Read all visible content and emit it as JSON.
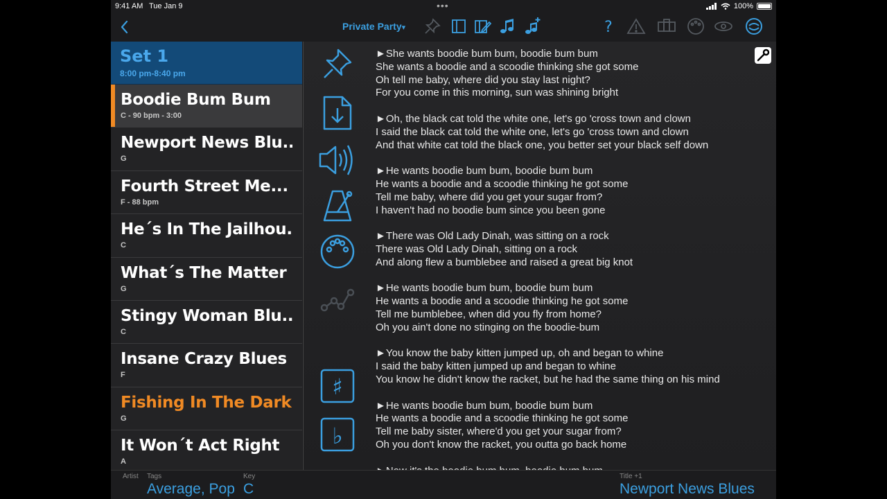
{
  "status_bar": {
    "time": "9:41 AM",
    "date": "Tue Jan 9",
    "battery": "100%"
  },
  "nav": {
    "set_name": "Private Party",
    "set_dropdown_glyph": "▾"
  },
  "set": {
    "name": "Set 1",
    "time": "8:00 pm-8:40 pm"
  },
  "songs": [
    {
      "title": "Boodie Bum Bum",
      "sub": "C - 90 bpm - 3:00"
    },
    {
      "title": "Newport News Blu...",
      "sub": "G"
    },
    {
      "title": "Fourth Street Me...",
      "sub": "F - 88 bpm"
    },
    {
      "title": "He´s In The Jailhou...",
      "sub": "C"
    },
    {
      "title": "What´s The Matter",
      "sub": "G"
    },
    {
      "title": "Stingy Woman Blu...",
      "sub": "C"
    },
    {
      "title": "Insane Crazy Blues",
      "sub": "F"
    },
    {
      "title": "Fishing In The Dark",
      "sub": "G"
    },
    {
      "title": "It Won´t Act Right",
      "sub": "A"
    }
  ],
  "lyrics": [
    [
      "►She wants boodie bum bum, boodie bum bum",
      "She wants a boodie and a scoodie thinking she got some",
      "Oh tell me baby, where did you stay last night?",
      "For you come in this morning, sun was shining bright"
    ],
    [
      "►Oh, the black cat told the white one, let's go 'cross town and clown",
      "I said the black cat told the white one, let's go 'cross town and clown",
      "And that white cat told the black one, you better set your black self down"
    ],
    [
      "►He wants boodie bum bum, boodie bum bum",
      "He wants a boodie and a scoodie thinking he got some",
      "Tell me baby, where did you get your sugar from?",
      "I haven't had no boodie bum since you been gone"
    ],
    [
      "►There was Old Lady Dinah, was sitting on a rock",
      "There was Old Lady Dinah, sitting on a rock",
      "And along flew a bumblebee and raised a great big knot"
    ],
    [
      "►He wants boodie bum bum, boodie bum bum",
      "He wants a boodie and a scoodie thinking he got some",
      "Tell me bumblebee, when did you fly from home?",
      "Oh you ain't done no stinging on the boodie-bum"
    ],
    [
      "►You know the baby kitten jumped up, oh and began to whine",
      "I said the baby kitten jumped up and began to whine",
      "You know he didn't know the racket, but he had the same thing on his mind"
    ],
    [
      "►He wants boodie bum bum, boodie bum bum",
      "He wants a boodie and a scoodie thinking he got some",
      "Tell me baby sister, where'd you get your sugar from?",
      "Oh you don't know the racket, you outta go back home"
    ],
    [
      "►Now it's the boodie bum bum, boodie bum bum"
    ]
  ],
  "footer": {
    "artist_label": "Artist",
    "tags_label": "Tags",
    "tags_value": "Average, Pop",
    "key_label": "Key",
    "key_value": "C",
    "next_label": "Title +1",
    "next_value": "Newport News Blues"
  },
  "colors": {
    "accent": "#3b9fe0",
    "selected_marker": "#f08a24",
    "set_header": "#134a78"
  }
}
